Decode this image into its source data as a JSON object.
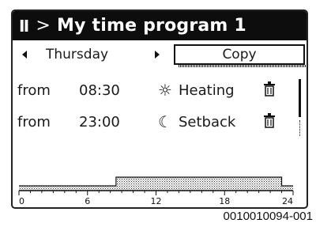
{
  "title": {
    "menu_icon": "menu-icon",
    "separator": ">",
    "text": "My time program 1"
  },
  "day_selector": {
    "day": "Thursday",
    "prev_icon": "arrow-left-icon",
    "next_icon": "arrow-right-icon"
  },
  "copy_button": {
    "label": "Copy"
  },
  "schedule": [
    {
      "from_label": "from",
      "time": "08:30",
      "mode": "Heating",
      "mode_icon": "sun-icon",
      "delete_icon": "trash-icon"
    },
    {
      "from_label": "from",
      "time": "23:00",
      "mode": "Setback",
      "mode_icon": "moon-icon",
      "delete_icon": "trash-icon"
    }
  ],
  "timeline": {
    "ticks": [
      "0",
      "6",
      "12",
      "18",
      "24"
    ],
    "heating_start_hour": 8.5,
    "heating_end_hour": 23.0
  },
  "caption": "0010010094-001",
  "colors": {
    "titlebar_bg": "#0d0d0d",
    "titlebar_fg": "#ffffff"
  }
}
